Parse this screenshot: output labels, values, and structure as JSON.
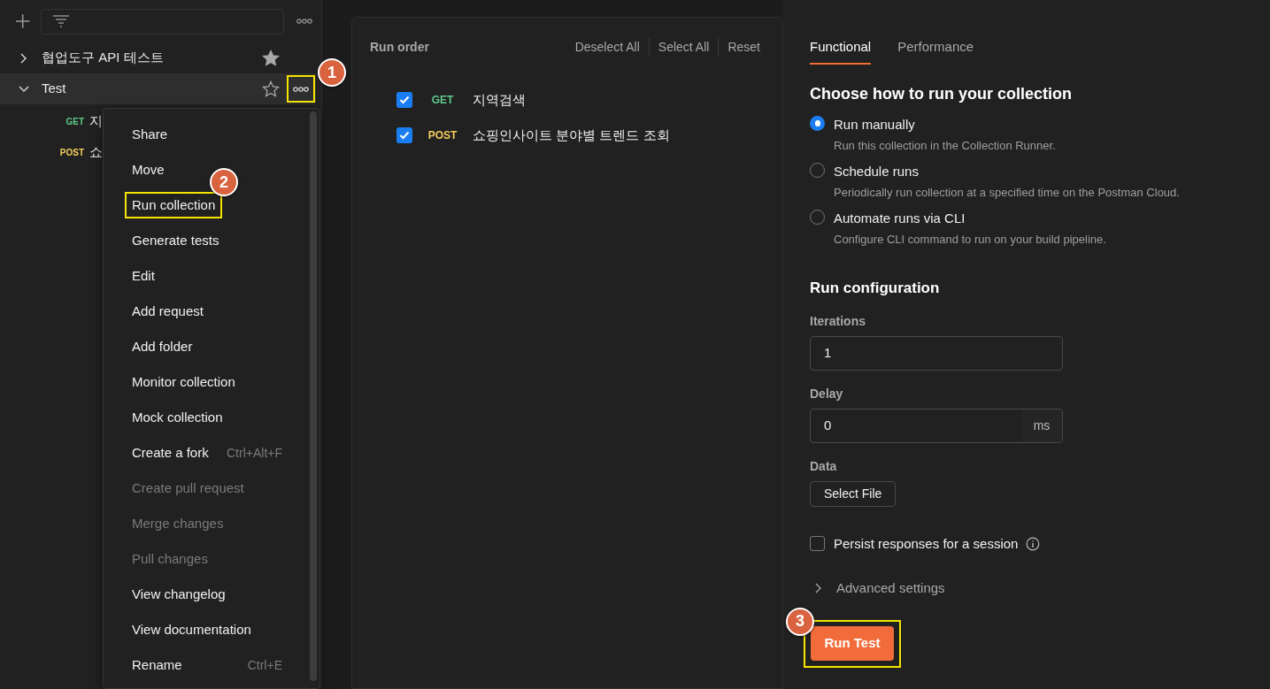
{
  "sidebar": {
    "collections": [
      {
        "name": "협업도구 API 테스트",
        "expanded": false,
        "starred": true,
        "selected": false
      },
      {
        "name": "Test",
        "expanded": true,
        "starred": false,
        "selected": true,
        "callout": "1",
        "children": [
          {
            "method": "GET",
            "name": "지"
          },
          {
            "method": "POST",
            "name": "쇼"
          }
        ]
      }
    ]
  },
  "context_menu": {
    "items": [
      {
        "label": "Share",
        "disabled": false
      },
      {
        "label": "Move",
        "disabled": false
      },
      {
        "label": "Run collection",
        "disabled": false,
        "callout": "2"
      },
      {
        "label": "Generate tests",
        "disabled": false
      },
      {
        "label": "Edit",
        "disabled": false
      },
      {
        "label": "Add request",
        "disabled": false
      },
      {
        "label": "Add folder",
        "disabled": false
      },
      {
        "label": "Monitor collection",
        "disabled": false
      },
      {
        "label": "Mock collection",
        "disabled": false
      },
      {
        "label": "Create a fork",
        "disabled": false,
        "shortcut": "Ctrl+Alt+F"
      },
      {
        "label": "Create pull request",
        "disabled": true
      },
      {
        "label": "Merge changes",
        "disabled": true
      },
      {
        "label": "Pull changes",
        "disabled": true
      },
      {
        "label": "View changelog",
        "disabled": false
      },
      {
        "label": "View documentation",
        "disabled": false
      },
      {
        "label": "Rename",
        "disabled": false,
        "shortcut": "Ctrl+E"
      }
    ]
  },
  "run_order": {
    "title": "Run order",
    "actions": [
      "Deselect All",
      "Select All",
      "Reset"
    ],
    "requests": [
      {
        "method": "GET",
        "name": "지역검색",
        "checked": true
      },
      {
        "method": "POST",
        "name": "쇼핑인사이트 분야별 트렌드 조회",
        "checked": true
      }
    ]
  },
  "runner": {
    "tabs": [
      {
        "label": "Functional",
        "selected": true
      },
      {
        "label": "Performance",
        "selected": false
      }
    ],
    "heading": "Choose how to run your collection",
    "options": [
      {
        "label": "Run manually",
        "description": "Run this collection in the Collection Runner.",
        "selected": true
      },
      {
        "label": "Schedule runs",
        "description": "Periodically run collection at a specified time on the Postman Cloud.",
        "selected": false
      },
      {
        "label": "Automate runs via CLI",
        "description": "Configure CLI command to run on your build pipeline.",
        "selected": false
      }
    ],
    "config_heading": "Run configuration",
    "iterations": {
      "label": "Iterations",
      "value": "1"
    },
    "delay": {
      "label": "Delay",
      "value": "0",
      "unit": "ms"
    },
    "data": {
      "label": "Data",
      "button": "Select File"
    },
    "persist": {
      "label": "Persist responses for a session",
      "checked": false
    },
    "advanced": {
      "label": "Advanced settings",
      "expanded": false
    },
    "run_button": {
      "label": "Run Test",
      "callout": "3"
    }
  }
}
